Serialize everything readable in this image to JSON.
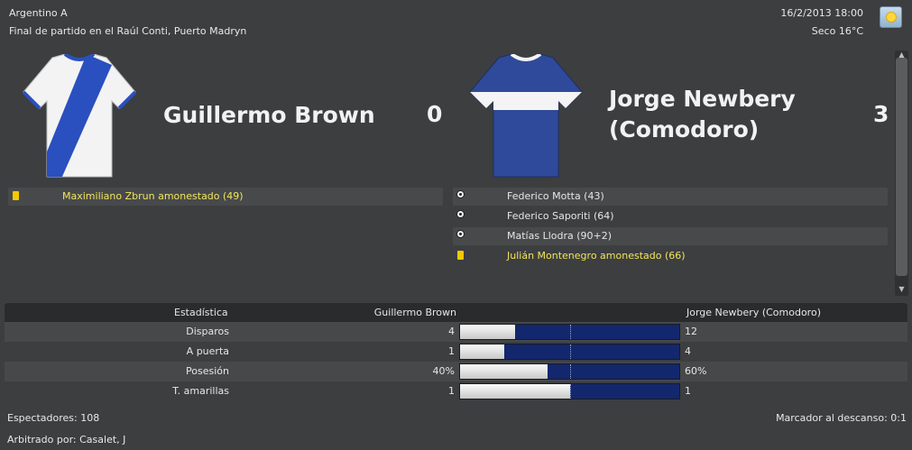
{
  "header": {
    "competition": "Argentino A",
    "match_info": "Final de partido en el Raúl Conti, Puerto Madryn",
    "datetime": "16/2/2013 18:00",
    "weather": "Seco 16°C",
    "weather_icon": "sun-icon"
  },
  "home": {
    "name": "Guillermo Brown",
    "score": "0",
    "shirt_colors": {
      "body": "#f4f4f4",
      "sash": "#2a4fbf"
    },
    "events": [
      {
        "type": "yellow-card",
        "text": "Maximiliano Zbrun amonestado (49)"
      }
    ]
  },
  "away": {
    "name_line1": "Jorge Newbery",
    "name_line2": "(Comodoro)",
    "score": "3",
    "shirt_colors": {
      "body": "#2f4a9a",
      "band": "#f4f4f4"
    },
    "events": [
      {
        "type": "goal",
        "text": "Federico Motta (43)"
      },
      {
        "type": "goal",
        "text": "Federico Saporiti (64)"
      },
      {
        "type": "goal",
        "text": "Matías Llodra (90+2)"
      },
      {
        "type": "yellow-card",
        "text": "Julián Montenegro amonestado (66)"
      }
    ]
  },
  "stats": {
    "header": {
      "label": "Estadística",
      "home": "Guillermo Brown",
      "away": "Jorge Newbery (Comodoro)"
    },
    "rows": [
      {
        "label": "Disparos",
        "home": "4",
        "away": "12",
        "home_share": 0.25
      },
      {
        "label": "A puerta",
        "home": "1",
        "away": "4",
        "home_share": 0.2
      },
      {
        "label": "Posesión",
        "home": "40%",
        "away": "60%",
        "home_share": 0.4
      },
      {
        "label": "T. amarillas",
        "home": "1",
        "away": "1",
        "home_share": 0.5
      }
    ]
  },
  "footer": {
    "attendance": "Espectadores: 108",
    "half_time": "Marcador al descanso: 0:1",
    "referee": "Arbitrado por: Casalet, J"
  },
  "colors": {
    "bar_home": "#e8e8e8",
    "bar_away": "#13276e",
    "yellow_text": "#f2e55a",
    "yellow_card": "#f5c800"
  }
}
